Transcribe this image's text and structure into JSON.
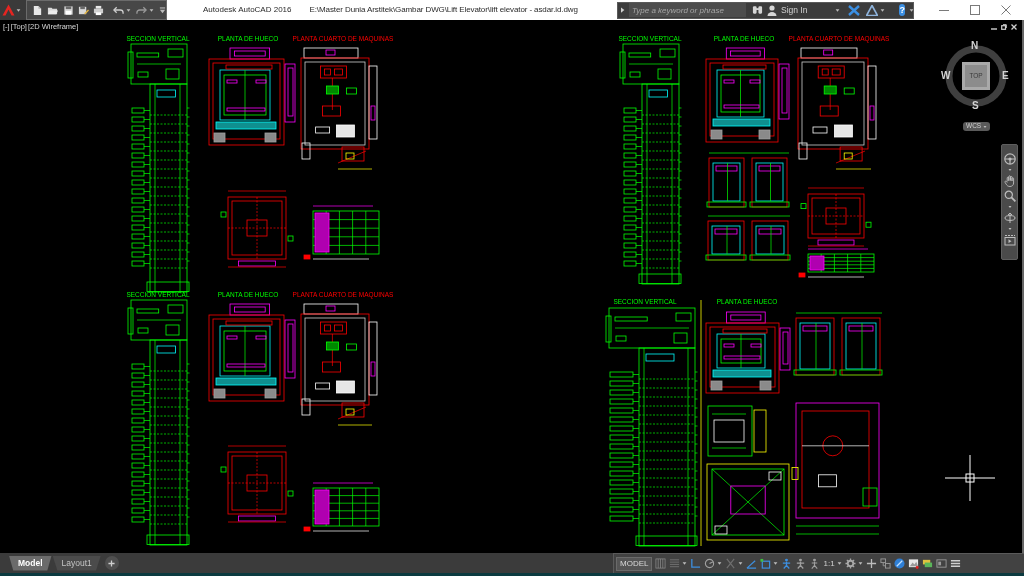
{
  "title_bar": {
    "app_title": "Autodesk AutoCAD 2016",
    "file_path": "E:\\Master Dunia Arstitek\\Gambar DWG\\Lift Elevator\\lift elevator - asdar.id.dwg",
    "search": {
      "placeholder": "Type a keyword or phrase"
    },
    "sign_in": "Sign In",
    "help": "?"
  },
  "viewport": {
    "controls": [
      "[-]",
      "[Top]",
      "[2D Wireframe]"
    ]
  },
  "sheets": [
    {
      "views": [
        {
          "kind": "section",
          "title": "SECCION VERTICAL"
        },
        {
          "kind": "shaft_plan",
          "title": "PLANTA DE HUECO"
        },
        {
          "kind": "machine_room",
          "title": "PLANTA CUARTO DE MAQUINAS"
        },
        {
          "kind": "beam_plan"
        },
        {
          "kind": "schedule_table"
        }
      ]
    },
    {
      "views": [
        {
          "kind": "section",
          "title": "SECCION VERTICAL"
        },
        {
          "kind": "shaft_plan",
          "title": "PLANTA DE HUECO"
        },
        {
          "kind": "machine_room",
          "title": "PLANTA CUARTO DE MAQUINAS"
        },
        {
          "kind": "door_detail"
        },
        {
          "kind": "beam_plan"
        },
        {
          "kind": "door_detail"
        },
        {
          "kind": "schedule_table"
        }
      ]
    },
    {
      "views": [
        {
          "kind": "section",
          "title": "SECCION VERTICAL"
        },
        {
          "kind": "shaft_plan",
          "title": "PLANTA DE HUECO"
        },
        {
          "kind": "machine_room",
          "title": "PLANTA CUARTO DE MAQUINAS"
        },
        {
          "kind": "beam_plan"
        },
        {
          "kind": "schedule_table"
        }
      ]
    },
    {
      "views": [
        {
          "kind": "section",
          "title": "SECCION VERTICAL"
        },
        {
          "kind": "shaft_plan",
          "title": "PLANTA DE HUECO"
        },
        {
          "kind": "door_detail"
        },
        {
          "kind": "pulley_room"
        },
        {
          "kind": "wall_detail"
        },
        {
          "kind": "roof_plan"
        }
      ]
    }
  ],
  "viewcube": {
    "north": "N",
    "east": "E",
    "south": "S",
    "west": "W",
    "face": "TOP",
    "coordinate_system": "WCS"
  },
  "layout_tabs": [
    {
      "label": "Model",
      "selected": true
    },
    {
      "label": "Layout1",
      "selected": false
    }
  ],
  "status_bar": {
    "space": "MODEL",
    "annotation_scale": "1:1"
  }
}
